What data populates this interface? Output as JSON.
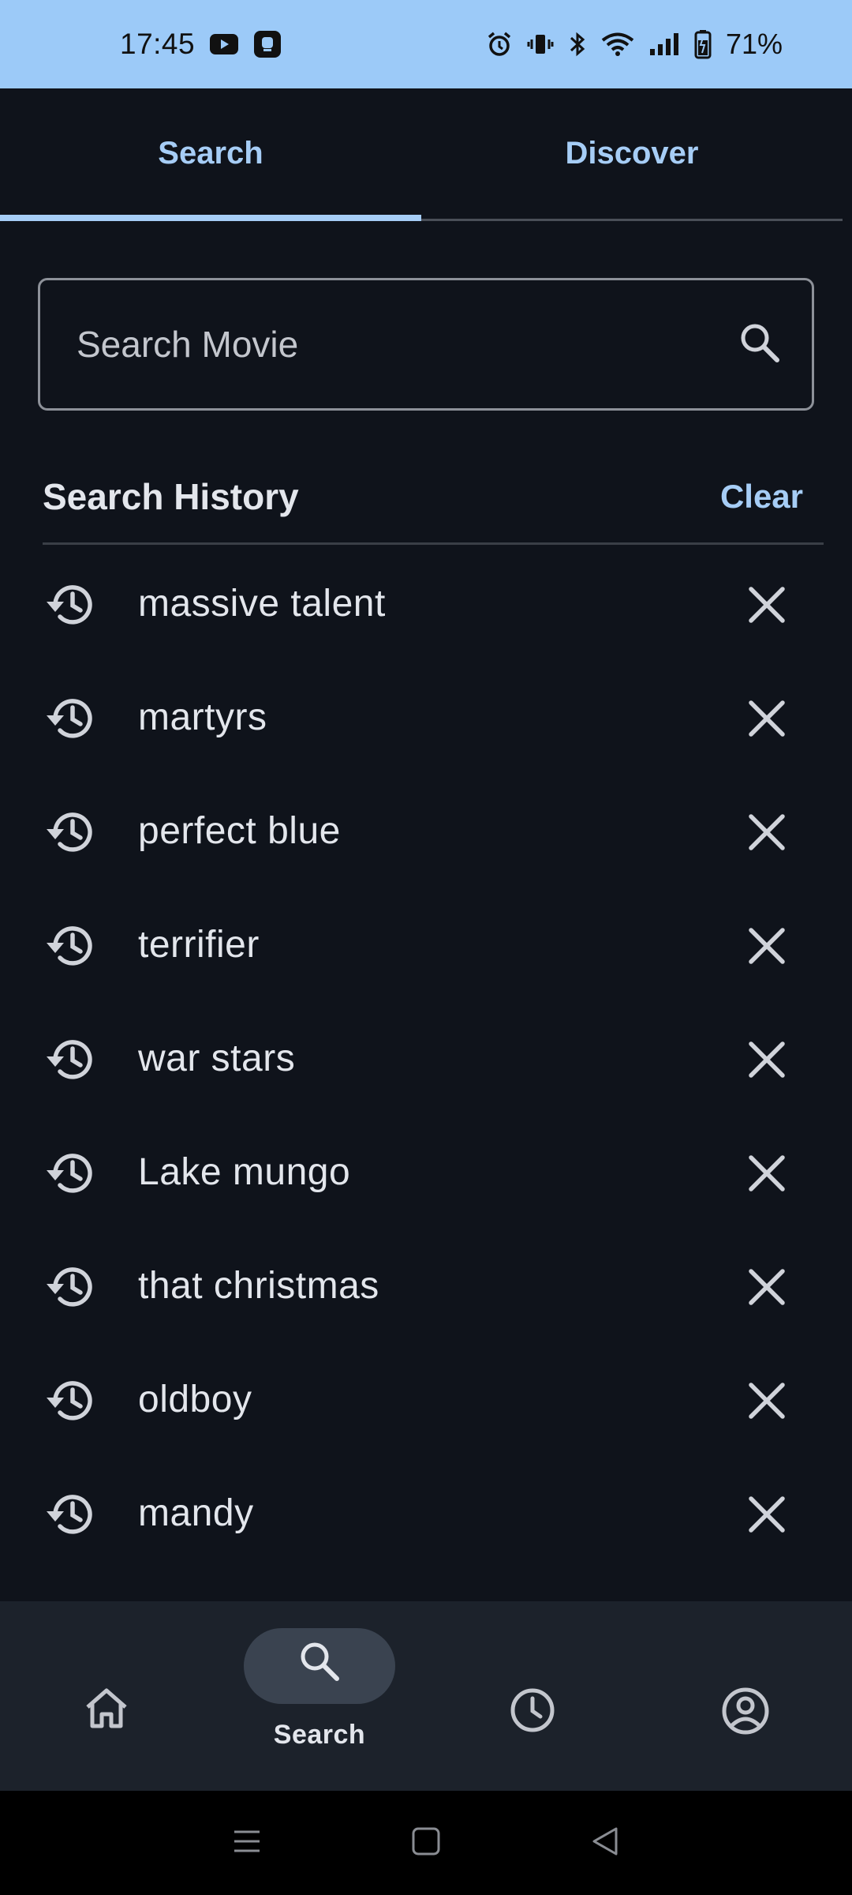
{
  "status_bar": {
    "time": "17:45",
    "battery": "71%",
    "left_icons": [
      "youtube-icon",
      "notification-app-icon"
    ],
    "right_icons": [
      "alarm-icon",
      "vibrate-icon",
      "bluetooth-icon",
      "wifi-icon",
      "signal-icon",
      "battery-icon"
    ]
  },
  "tabs": [
    {
      "label": "Search",
      "active": true
    },
    {
      "label": "Discover",
      "active": false
    }
  ],
  "search": {
    "placeholder": "Search Movie",
    "value": ""
  },
  "history": {
    "title": "Search History",
    "clear_label": "Clear",
    "items": [
      "massive talent",
      "martyrs",
      "perfect blue",
      "terrifier",
      "war stars",
      "Lake mungo",
      "that christmas",
      "oldboy",
      "mandy"
    ]
  },
  "bottom_nav": {
    "items": [
      {
        "icon": "home-icon",
        "label": ""
      },
      {
        "icon": "search-icon",
        "label": "Search",
        "active": true
      },
      {
        "icon": "clock-icon",
        "label": ""
      },
      {
        "icon": "account-icon",
        "label": ""
      }
    ]
  },
  "colors": {
    "accent": "#a6cdf6",
    "background": "#0f131b",
    "status_bar": "#9ccaf8",
    "nav_background": "#1c222b"
  }
}
